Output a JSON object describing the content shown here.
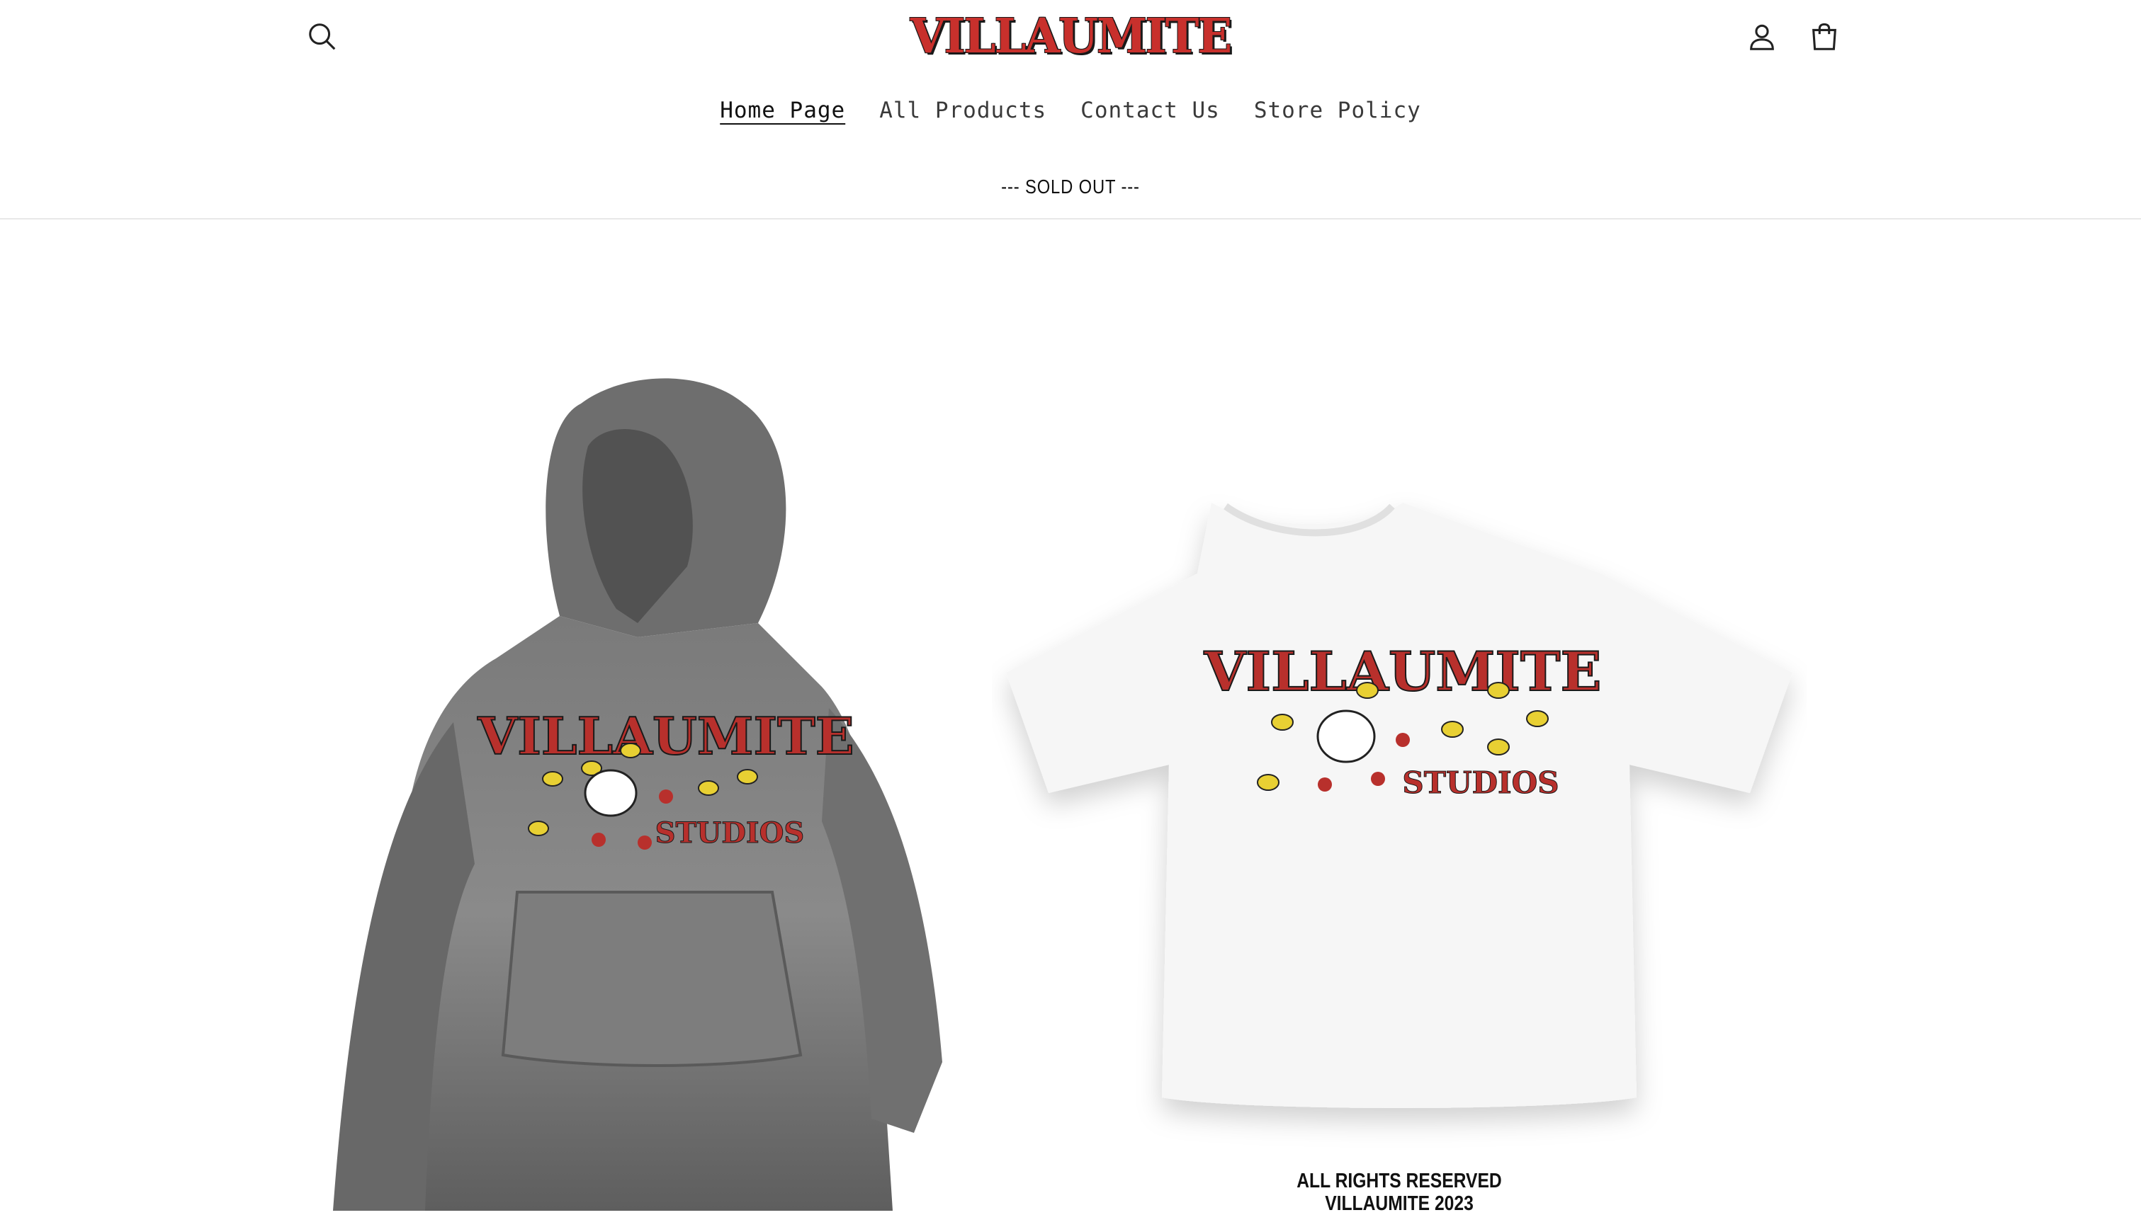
{
  "header": {
    "logo_text": "VILLAUMITE",
    "search_icon": "search-icon",
    "account_icon": "user-icon",
    "cart_icon": "bag-icon"
  },
  "nav": [
    {
      "label": "Home Page",
      "active": true
    },
    {
      "label": "All Products",
      "active": false
    },
    {
      "label": "Contact Us",
      "active": false
    },
    {
      "label": "Store Policy",
      "active": false
    }
  ],
  "announcement": "--- SOLD OUT ---",
  "products": {
    "hoodie": {
      "graphic_line1": "VILLAUMITE",
      "graphic_line2": "STUDIOS"
    },
    "tee": {
      "graphic_line1": "VILLAUMITE",
      "graphic_line2": "STUDIOS"
    }
  },
  "caption": {
    "line1": "ALL RIGHTS RESERVED",
    "line2": "VILLAUMITE 2023"
  },
  "colors": {
    "brand_red": "#c8302c",
    "hoodie_gray": "#6b6b6b",
    "tee_white": "#f7f7f7"
  }
}
